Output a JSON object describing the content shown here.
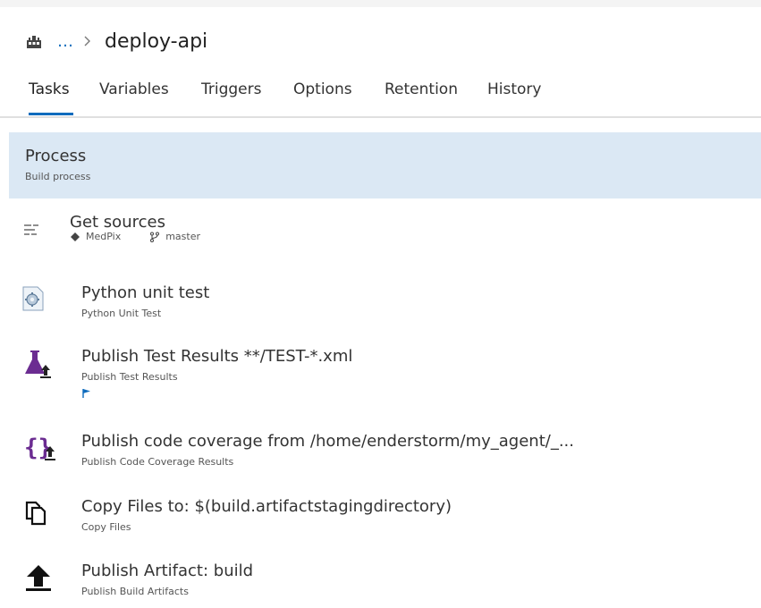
{
  "breadcrumb": {
    "ellipsis": "…",
    "title": "deploy-api",
    "icon": "pipeline-icon"
  },
  "tabs": [
    {
      "label": "Tasks",
      "active": true
    },
    {
      "label": "Variables"
    },
    {
      "label": "Triggers"
    },
    {
      "label": "Options"
    },
    {
      "label": "Retention"
    },
    {
      "label": "History"
    }
  ],
  "process": {
    "title": "Process",
    "subtitle": "Build process"
  },
  "tasks": [
    {
      "title": "Get sources",
      "repo": "MedPix",
      "branch": "master",
      "icon": "source-list-icon"
    },
    {
      "title": "Python unit test",
      "subtitle": "Python Unit Test",
      "icon": "gear-script-icon"
    },
    {
      "title": "Publish Test Results **/TEST-*.xml",
      "subtitle": "Publish Test Results",
      "icon": "flask-upload-icon",
      "flag_icon": "flag-icon"
    },
    {
      "title": "Publish code coverage from /home/enderstorm/my_agent/_...",
      "subtitle": "Publish Code Coverage Results",
      "icon": "braces-upload-icon"
    },
    {
      "title": "Copy Files to: $(build.artifactstagingdirectory)",
      "subtitle": "Copy Files",
      "icon": "copy-files-icon"
    },
    {
      "title": "Publish Artifact: build",
      "subtitle": "Publish Build Artifacts",
      "icon": "upload-arrow-icon"
    }
  ],
  "colors": {
    "accent": "#0f6cbd",
    "process_bg": "#dbe8f4",
    "purple": "#6b2c91"
  }
}
